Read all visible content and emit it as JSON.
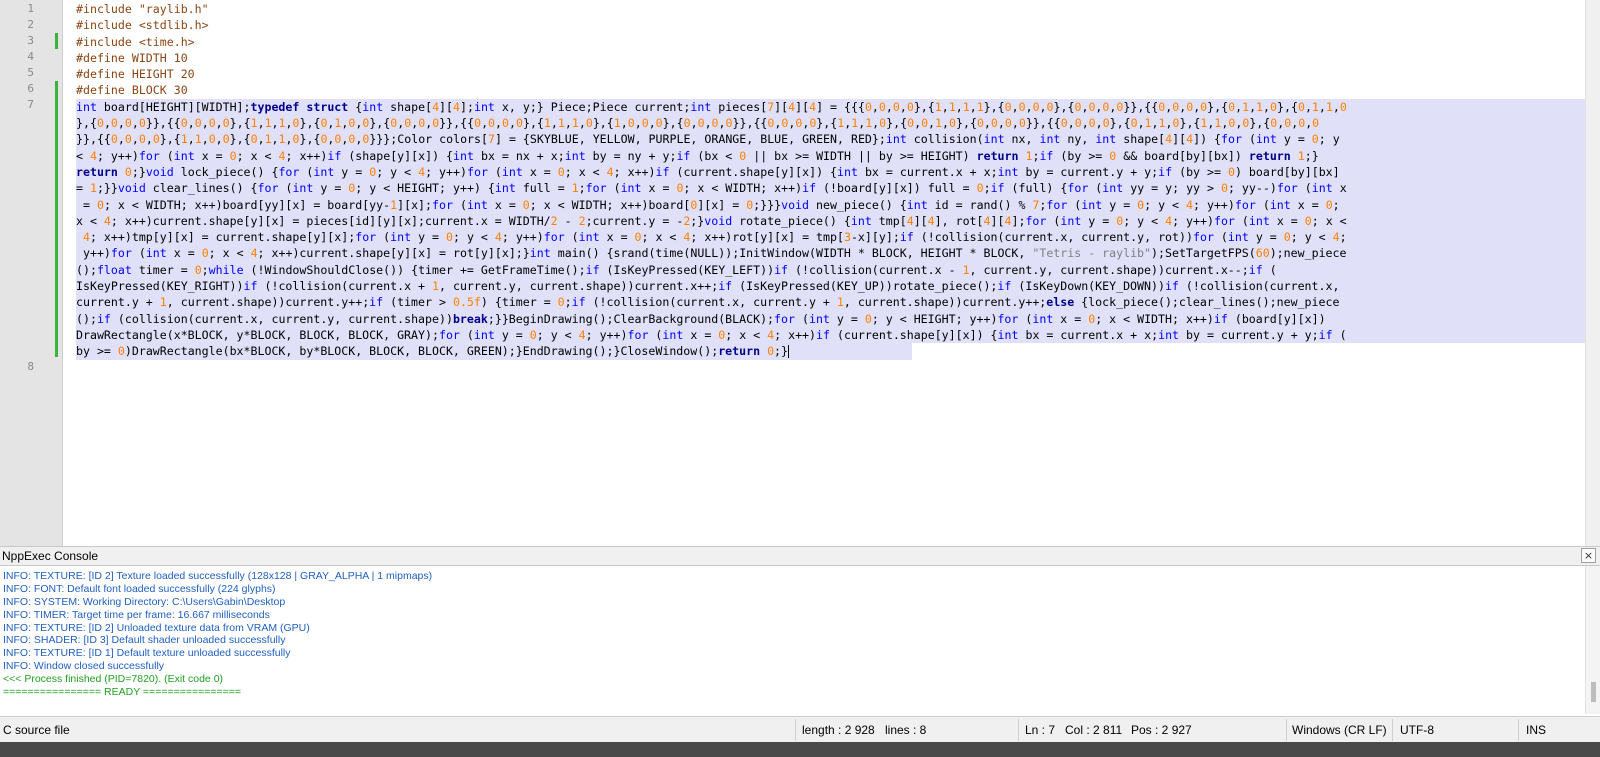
{
  "editor": {
    "line_numbers": [
      "1",
      "2",
      "3",
      "4",
      "5",
      "6",
      "7",
      "8"
    ],
    "lines": {
      "l1": "#include \"raylib.h\"",
      "l2": "#include <stdlib.h>",
      "l3": "#include <time.h>",
      "l4": "#define WIDTH 10",
      "l5": "#define HEIGHT 20",
      "l6": "#define BLOCK 30",
      "w1": "int board[HEIGHT][WIDTH];typedef struct {int shape[4][4];int x, y;} Piece;Piece current;int pieces[7][4][4] = {{{0,0,0,0},{1,1,1,1},{0,0,0,0},{0,0,0,0}},{{0,0,0,0},{0,1,1,0},{0,1,1,0",
      "w2": "},{0,0,0,0}},{{0,0,0,0},{1,1,1,0},{0,1,0,0},{0,0,0,0}},{{0,0,0,0},{1,1,1,0},{1,0,0,0},{0,0,0,0}},{{0,0,0,0},{1,1,1,0},{0,0,1,0},{0,0,0,0}},{{0,0,0,0},{0,1,1,0},{1,1,0,0},{0,0,0,0",
      "w3": "}},{{0,0,0,0},{1,1,0,0},{0,1,1,0},{0,0,0,0}}};Color colors[7] = {SKYBLUE, YELLOW, PURPLE, ORANGE, BLUE, GREEN, RED};int collision(int nx, int ny, int shape[4][4]) {for (int y = 0; y",
      "w4": "< 4; y++)for (int x = 0; x < 4; x++)if (shape[y][x]) {int bx = nx + x;int by = ny + y;if (bx < 0 || bx >= WIDTH || by >= HEIGHT) return 1;if (by >= 0 && board[by][bx]) return 1;}",
      "w5": "return 0;}void lock_piece() {for (int y = 0; y < 4; y++)for (int x = 0; x < 4; x++)if (current.shape[y][x]) {int bx = current.x + x;int by = current.y + y;if (by >= 0) board[by][bx]",
      "w6": "= 1;}}void clear_lines() {for (int y = 0; y < HEIGHT; y++) {int full = 1;for (int x = 0; x < WIDTH; x++)if (!board[y][x]) full = 0;if (full) {for (int yy = y; yy > 0; yy--)for (int x",
      "w7": " = 0; x < WIDTH; x++)board[yy][x] = board[yy-1][x];for (int x = 0; x < WIDTH; x++)board[0][x] = 0;}}}void new_piece() {int id = rand() % 7;for (int y = 0; y < 4; y++)for (int x = 0;",
      "w8": "x < 4; x++)current.shape[y][x] = pieces[id][y][x];current.x = WIDTH/2 - 2;current.y = -2;}void rotate_piece() {int tmp[4][4], rot[4][4];for (int y = 0; y < 4; y++)for (int x = 0; x <",
      "w9": " 4; x++)tmp[y][x] = current.shape[y][x];for (int y = 0; y < 4; y++)for (int x = 0; x < 4; x++)rot[y][x] = tmp[3-x][y];if (!collision(current.x, current.y, rot))for (int y = 0; y < 4;",
      "w10": " y++)for (int x = 0; x < 4; x++)current.shape[y][x] = rot[y][x];}int main() {srand(time(NULL));InitWindow(WIDTH * BLOCK, HEIGHT * BLOCK, \"Tetris - raylib\");SetTargetFPS(60);new_piece",
      "w11": "();float timer = 0;while (!WindowShouldClose()) {timer += GetFrameTime();if (IsKeyPressed(KEY_LEFT))if (!collision(current.x - 1, current.y, current.shape))current.x--;if (",
      "w12": "IsKeyPressed(KEY_RIGHT))if (!collision(current.x + 1, current.y, current.shape))current.x++;if (IsKeyPressed(KEY_UP))rotate_piece();if (IsKeyDown(KEY_DOWN))if (!collision(current.x,",
      "w13": "current.y + 1, current.shape))current.y++;if (timer > 0.5f) {timer = 0;if (!collision(current.x, current.y + 1, current.shape))current.y++;else {lock_piece();clear_lines();new_piece",
      "w14": "();if (collision(current.x, current.y, current.shape))break;}}BeginDrawing();ClearBackground(BLACK);for (int y = 0; y < HEIGHT; y++)for (int x = 0; x < WIDTH; x++)if (board[y][x])",
      "w15": "DrawRectangle(x*BLOCK, y*BLOCK, BLOCK, BLOCK, GRAY);for (int y = 0; y < 4; y++)for (int x = 0; x < 4; x++)if (current.shape[y][x]) {int bx = current.x + x;int by = current.y + y;if (",
      "w16": "by >= 0)DrawRectangle(bx*BLOCK, by*BLOCK, BLOCK, BLOCK, GREEN);}EndDrawing();}CloseWindow();return 0;}"
    }
  },
  "console": {
    "title": "NppExec Console",
    "close_symbol": "×",
    "lines": [
      "INFO: TEXTURE: [ID 2] Texture loaded successfully (128x128 | GRAY_ALPHA | 1 mipmaps)",
      "INFO: FONT: Default font loaded successfully (224 glyphs)",
      "INFO: SYSTEM: Working Directory: C:\\Users\\Gabin\\Desktop",
      "INFO: TIMER: Target time per frame: 16.667 milliseconds",
      "INFO: TEXTURE: [ID 2] Unloaded texture data from VRAM (GPU)",
      "INFO: SHADER: [ID 3] Default shader unloaded successfully",
      "INFO: TEXTURE: [ID 1] Default texture unloaded successfully",
      "INFO: Window closed successfully",
      "<<< Process finished (PID=7820). (Exit code 0)",
      "================ READY ================"
    ]
  },
  "statusbar": {
    "file_type": "C source file",
    "length": "length : 2 928",
    "lines": "lines : 8",
    "ln": "Ln : 7",
    "col": "Col : 2 811",
    "pos": "Pos : 2 927",
    "eol": "Windows (CR LF)",
    "encoding": "UTF-8",
    "mode": "INS"
  },
  "colors": {
    "preprocessor": "#8b4513",
    "keyword": "#0000ff",
    "number": "#ff8000",
    "selection": "#e0e0f8",
    "console_info": "#2060c0",
    "console_ok": "#20a020",
    "change_marker": "#3cb43c"
  }
}
